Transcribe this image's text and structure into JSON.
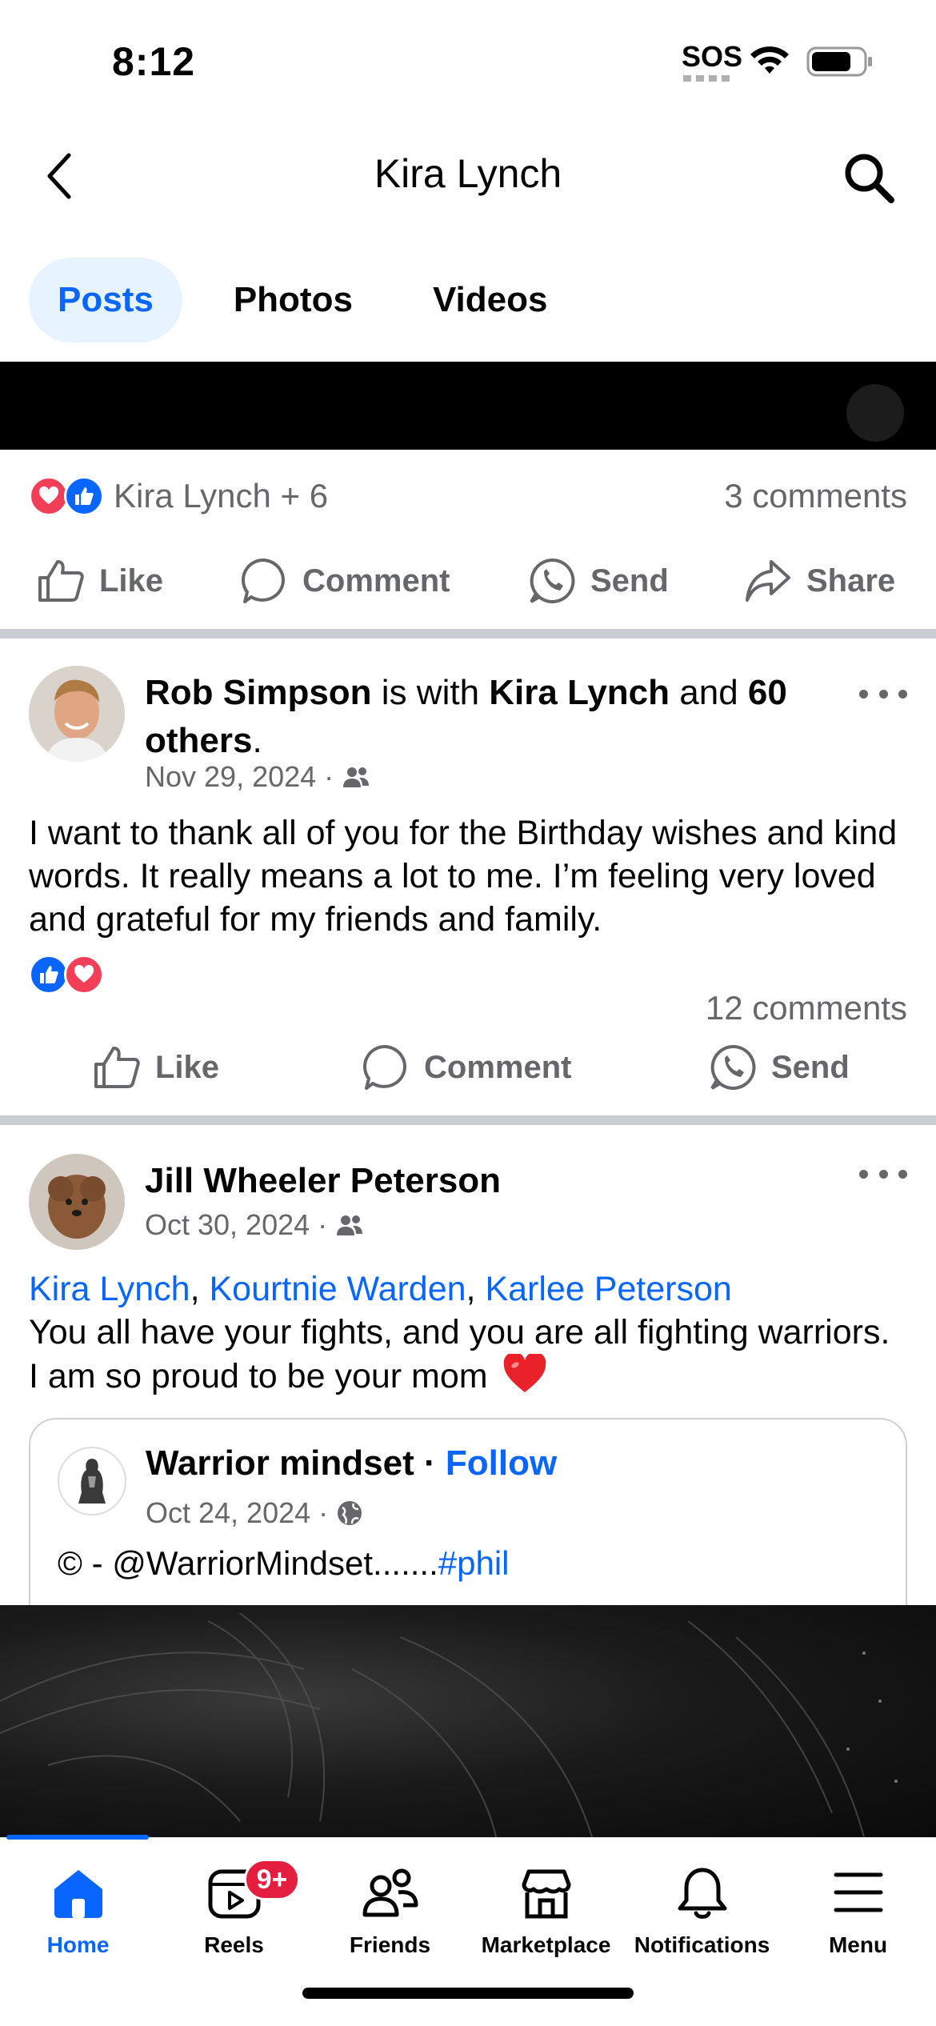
{
  "status_bar": {
    "time": "8:12",
    "sos": "SOS"
  },
  "header": {
    "title": "Kira Lynch"
  },
  "tabs": [
    {
      "label": "Posts",
      "active": true
    },
    {
      "label": "Photos",
      "active": false
    },
    {
      "label": "Videos",
      "active": false
    }
  ],
  "post1": {
    "reactions_text": "Kira Lynch + 6",
    "comments": "3 comments",
    "actions": {
      "like": "Like",
      "comment": "Comment",
      "send": "Send",
      "share": "Share"
    }
  },
  "post2": {
    "author": "Rob Simpson",
    "is_with": " is with ",
    "tagged": "Kira Lynch",
    "and": " and ",
    "others": "60 others",
    "period": ".",
    "date": "Nov 29, 2024",
    "body": "I want to thank all of you for the Birthday wishes and kind words. It really means a lot to me. I’m feeling very loved and grateful for my friends and family.",
    "comments": "12 comments",
    "actions": {
      "like": "Like",
      "comment": "Comment",
      "send": "Send"
    }
  },
  "post3": {
    "author": "Jill Wheeler Peterson",
    "date": "Oct 30, 2024",
    "mentions": [
      "Kira Lynch",
      "Kourtnie Warden",
      "Karlee Peterson"
    ],
    "body": "You all have your fights, and you are all fighting warriors. I am so proud to be your mom",
    "shared": {
      "page_name": "Warrior mindset",
      "follow": "Follow",
      "date": "Oct 24, 2024",
      "text_prefix": "© - @WarriorMindset.......",
      "hashtag": "#phil"
    }
  },
  "bottom_nav": [
    {
      "label": "Home",
      "icon": "home-icon",
      "active": true
    },
    {
      "label": "Reels",
      "icon": "reels-icon",
      "badge": "9+"
    },
    {
      "label": "Friends",
      "icon": "friends-icon"
    },
    {
      "label": "Marketplace",
      "icon": "marketplace-icon"
    },
    {
      "label": "Notifications",
      "icon": "bell-icon"
    },
    {
      "label": "Menu",
      "icon": "menu-icon"
    }
  ],
  "colors": {
    "accent": "#0866ff",
    "love": "#f33e58",
    "badge": "#e41e3f",
    "secondary_text": "#65676b"
  }
}
